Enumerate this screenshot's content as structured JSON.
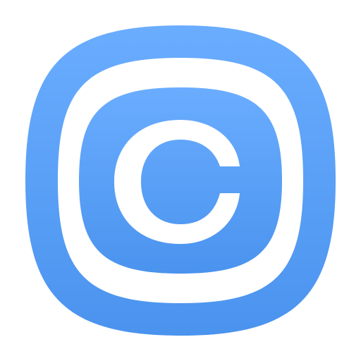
{
  "app_icon": {
    "icon_name": "copyright-icon",
    "colors": {
      "background_top": "#6aadff",
      "background_bottom": "#4a93ee",
      "foreground": "#ffffff"
    }
  }
}
